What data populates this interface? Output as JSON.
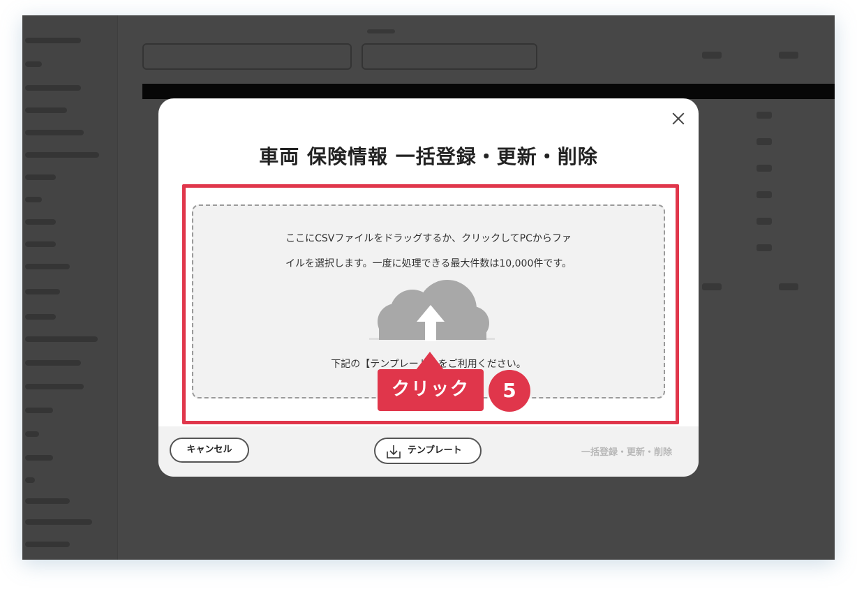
{
  "modal": {
    "title": "車両 保険情報 一括登録・更新・削除",
    "dropzone": {
      "line1": "ここにCSVファイルをドラッグするか、クリックしてPCからファ",
      "line2": "イルを選択します。一度に処理できる最大件数は10,000件です。",
      "note": "下記の【テンプレート】をご利用ください。"
    },
    "footer": {
      "cancel_label": "キャンセル",
      "template_label": "テンプレート",
      "bulk_label": "一括登録・更新・削除"
    }
  },
  "annotation": {
    "tooltip_label": "クリック",
    "step_number": "5",
    "accent_color": "#e0364b"
  },
  "icons": {
    "close": "close-icon",
    "upload": "cloud-upload-icon",
    "download": "download-icon"
  }
}
